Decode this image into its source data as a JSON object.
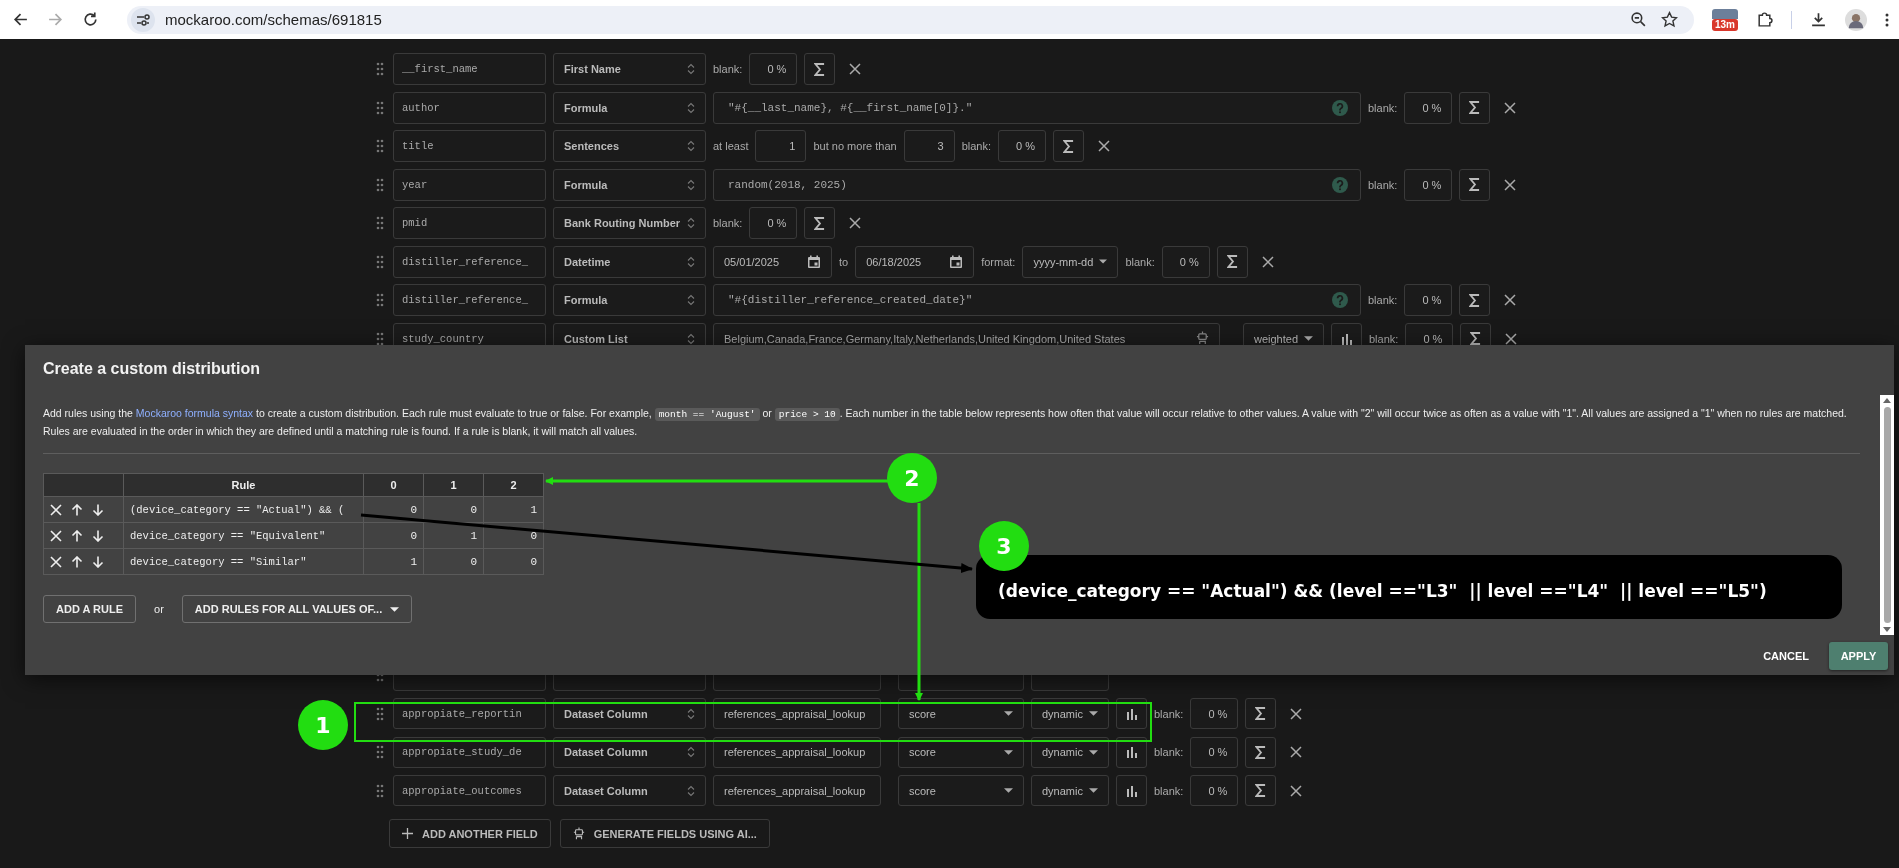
{
  "browser": {
    "url": "mockaroo.com/schemas/691815",
    "badge": "13m"
  },
  "fields_top": [
    {
      "name": "__first_name",
      "type": "First Name",
      "kind": "plain",
      "blank_label": "blank:",
      "blank": "0 %"
    },
    {
      "name": "author",
      "type": "Formula",
      "kind": "formula",
      "formula": "\"#{__last_name}, #{__first_name[0]}.\"",
      "blank_label": "blank:",
      "blank": "0 %"
    },
    {
      "name": "title",
      "type": "Sentences",
      "kind": "sentences",
      "min_label": "at least",
      "min": "1",
      "max_label": "but no more than",
      "max": "3",
      "blank_label": "blank:",
      "blank": "0 %"
    },
    {
      "name": "year",
      "type": "Formula",
      "kind": "formula",
      "formula": "random(2018, 2025)",
      "blank_label": "blank:",
      "blank": "0 %"
    },
    {
      "name": "pmid",
      "type": "Bank Routing Number",
      "kind": "plain",
      "blank_label": "blank:",
      "blank": "0 %"
    },
    {
      "name": "distiller_reference_",
      "type": "Datetime",
      "kind": "datetime",
      "from": "05/01/2025",
      "to_label": "to",
      "to": "06/18/2025",
      "format_label": "format:",
      "format": "yyyy-mm-dd",
      "blank_label": "blank:",
      "blank": "0 %"
    },
    {
      "name": "distiller_reference_",
      "type": "Formula",
      "kind": "formula",
      "formula": "\"#{distiller_reference_created_date}\"",
      "blank_label": "blank:",
      "blank": "0 %"
    },
    {
      "name": "study_country",
      "type": "Custom List",
      "kind": "list",
      "values": "Belgium,Canada,France,Germany,Italy,Netherlands,United Kingdom,United States",
      "distribution": "weighted",
      "blank_label": "blank:",
      "blank": "0 %"
    }
  ],
  "fields_bottom": [
    {
      "kind": "covered"
    },
    {
      "name": "appropiate_reportin",
      "type": "Dataset Column",
      "kind": "dataset",
      "dataset": "references_appraisal_lookup",
      "column": "score",
      "distribution": "dynamic",
      "blank_label": "blank:",
      "blank": "0 %"
    },
    {
      "name": "appropiate_study_de",
      "type": "Dataset Column",
      "kind": "dataset",
      "dataset": "references_appraisal_lookup",
      "column": "score",
      "distribution": "dynamic",
      "blank_label": "blank:",
      "blank": "0 %"
    },
    {
      "name": "appropiate_outcomes",
      "type": "Dataset Column",
      "kind": "dataset",
      "dataset": "references_appraisal_lookup",
      "column": "score",
      "distribution": "dynamic",
      "blank_label": "blank:",
      "blank": "0 %"
    }
  ],
  "actions": {
    "add_field": "ADD ANOTHER FIELD",
    "generate": "GENERATE FIELDS USING AI..."
  },
  "dialog": {
    "title": "Create a custom distribution",
    "description": [
      {
        "kind": "text",
        "text": "Add rules using the "
      },
      {
        "kind": "link",
        "text": "Mockaroo formula syntax"
      },
      {
        "kind": "text",
        "text": " to create a custom distribution. Each rule must evaluate to true or false. For example, "
      },
      {
        "kind": "code",
        "text": "month == 'August'"
      },
      {
        "kind": "text",
        "text": " or "
      },
      {
        "kind": "code",
        "text": "price > 10"
      },
      {
        "kind": "text",
        "text": ". Each number in the table below represents how often that value will occur relative to other values. A value with \"2\" will occur twice as often as a value with \"1\". All values are assigned a \"1\" when no rules are matched. Rules are evaluated in the order in which they are defined until a matching rule is found. If a rule is blank, it will match all values."
      }
    ],
    "columns": [
      "Rule",
      "0",
      "1",
      "2"
    ],
    "rules": [
      {
        "rule": "(device_category == \"Actual\") && (",
        "values": [
          "0",
          "0",
          "1"
        ]
      },
      {
        "rule": "device_category == \"Equivalent\"",
        "values": [
          "0",
          "1",
          "0"
        ]
      },
      {
        "rule": "device_category == \"Similar\"",
        "values": [
          "1",
          "0",
          "0"
        ]
      }
    ],
    "add_rule": "ADD A RULE",
    "or": "or",
    "add_all": "ADD RULES FOR ALL VALUES OF...",
    "cancel": "CANCEL",
    "apply": "APPLY"
  },
  "annotations": {
    "steps": [
      "1",
      "2",
      "3"
    ],
    "callout": "(device_category == \"Actual\") && (level ==\"L3\"  || level ==\"L4\"  || level ==\"L5\")"
  }
}
